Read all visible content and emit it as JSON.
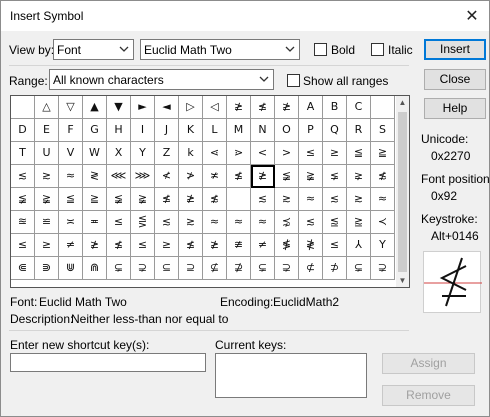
{
  "window": {
    "title": "Insert Symbol",
    "close_glyph": "✕"
  },
  "view_by": {
    "label": "View by:",
    "mode": "Font",
    "font": "Euclid Math Two"
  },
  "options": {
    "bold": "Bold",
    "italic": "Italic",
    "show_all_ranges": "Show all ranges"
  },
  "range": {
    "label": "Range:",
    "value": "All known characters"
  },
  "buttons": {
    "insert": "Insert",
    "close": "Close",
    "help": "Help",
    "assign": "Assign",
    "remove": "Remove"
  },
  "unicode": {
    "label": "Unicode:",
    "value": "0x2270"
  },
  "font_position": {
    "label": "Font position:",
    "value": "0x92"
  },
  "keystroke": {
    "label": "Keystroke:",
    "value": "Alt+0146"
  },
  "info": {
    "font_label": "Font:",
    "font_value": "Euclid Math Two",
    "encoding_label": "Encoding:",
    "encoding_value": "EuclidMath2",
    "description_label": "Description:",
    "description_value": "Neither less-than nor equal to"
  },
  "shortcut": {
    "label": "Enter new shortcut key(s):",
    "current_label": "Current keys:"
  },
  "selected_cell": {
    "row": 3,
    "col": 10
  },
  "symbols": [
    [
      "",
      "△",
      "▽",
      "▲",
      "▼",
      "►",
      "◄",
      "▷",
      "◁",
      "≱",
      "≰",
      "≱",
      "A",
      "B",
      "C"
    ],
    [
      "D",
      "E",
      "F",
      "G",
      "H",
      "I",
      "J",
      "K",
      "L",
      "M",
      "N",
      "O",
      "P",
      "Q",
      "R",
      "S"
    ],
    [
      "T",
      "U",
      "V",
      "W",
      "X",
      "Y",
      "Z",
      "k",
      "⋖",
      "⋗",
      "<",
      ">",
      "≤",
      "≥",
      "≦",
      "≧"
    ],
    [
      "≲",
      "≳",
      "≈",
      "≷",
      "⋘",
      "⋙",
      "≮",
      "≯",
      "≭",
      "≰",
      "≱",
      "≨",
      "≩",
      "⪇",
      "⪈",
      "≴"
    ],
    [
      "≨",
      "≩",
      "≦",
      "≧",
      "≨",
      "≩",
      "≰",
      "≱",
      "≴",
      "",
      "≲",
      "≳",
      "≈",
      "≲",
      "≳",
      "≈"
    ],
    [
      "≊",
      "≌",
      "≍",
      "≖",
      "≤",
      "⋚",
      "≲",
      "≳",
      "≈",
      "≈",
      "≈",
      "⋨",
      "≲",
      "⪍",
      "⪎",
      "≺"
    ],
    [
      "≤",
      "≥",
      "≠",
      "≱",
      "≰",
      "≤",
      "≥",
      "≰",
      "≱",
      "≇",
      "≠",
      "≸",
      "≹",
      "≤",
      "⅄",
      "Y"
    ],
    [
      "⋐",
      "⋑",
      "⋓",
      "⋒",
      "⊊",
      "⊋",
      "⊆",
      "⊇",
      "⊈",
      "⊉",
      "⊊",
      "⊋",
      "⊄",
      "⊅",
      "⊊",
      "⊋"
    ]
  ]
}
